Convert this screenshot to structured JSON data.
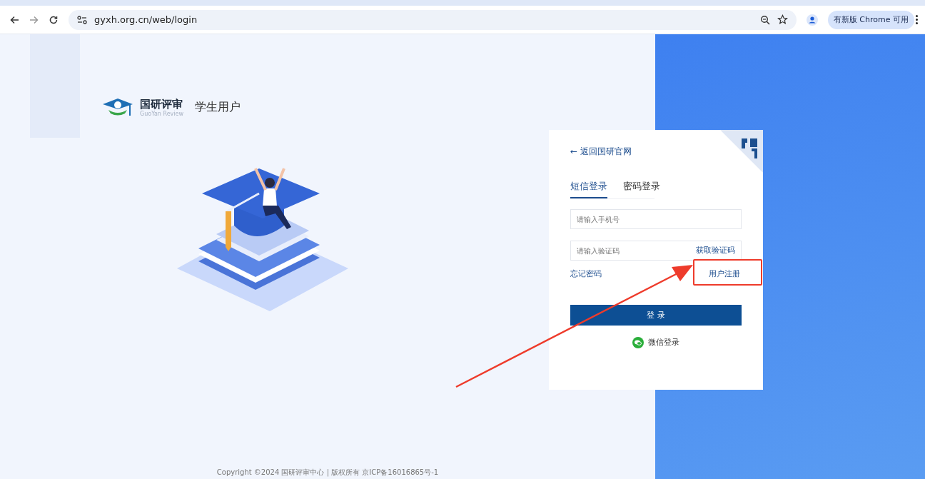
{
  "browser": {
    "url": "gyxh.org.cn/web/login",
    "update_notice": "有新版 Chrome 可用"
  },
  "brand": {
    "name": "国研评审",
    "subtitle": "GuoYan Review",
    "user_type": "学生用户"
  },
  "login": {
    "back_link": "← 返回国研官网",
    "tabs": [
      {
        "label": "短信登录",
        "selected": true
      },
      {
        "label": "密码登录",
        "selected": false
      }
    ],
    "fields": [
      {
        "kind": "phone",
        "placeholder": "请输入手机号"
      },
      {
        "kind": "code",
        "placeholder": "请输入验证码",
        "action": "获取验证码"
      }
    ],
    "forgot_link": "忘记密码",
    "register_link": "用户注册",
    "submit": "登 录",
    "wechat_login": "微信登录"
  },
  "footer": {
    "copyright": "Copyright ©2024 国研评审中心 | 版权所有 京ICP备16016865号-1"
  }
}
